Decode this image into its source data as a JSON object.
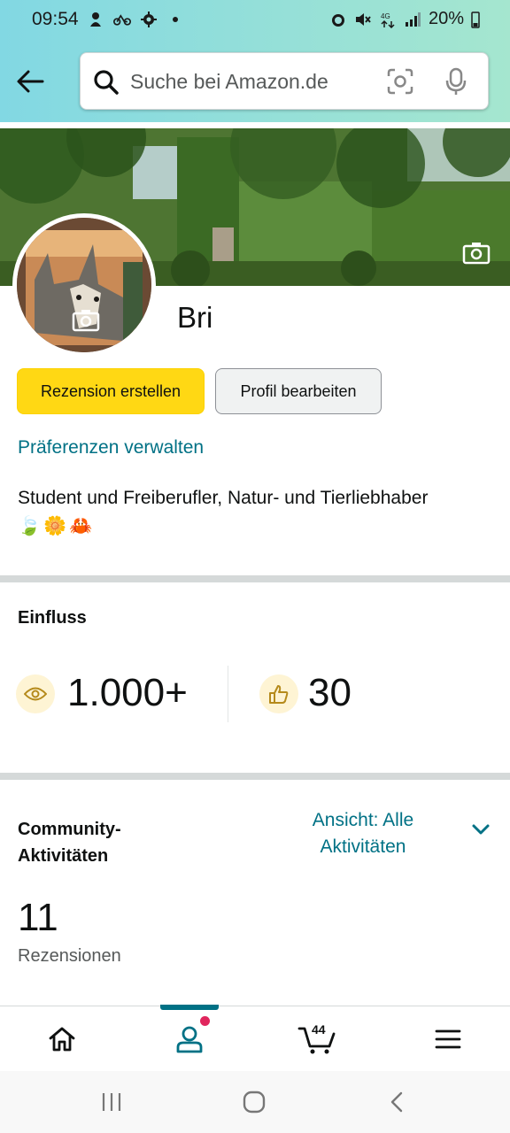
{
  "status_bar": {
    "time": "09:54",
    "battery": "20%",
    "network": "4G",
    "left_icons": [
      "notification-icon",
      "bike-icon",
      "settings-icon",
      "dot-icon"
    ],
    "right_icons": [
      "alarm-icon",
      "mute-icon",
      "data-icon",
      "signal-icon",
      "battery-icon"
    ]
  },
  "header": {
    "search_placeholder": "Suche bei Amazon.de"
  },
  "profile": {
    "name": "Bri",
    "create_review_label": "Rezension erstellen",
    "edit_profile_label": "Profil bearbeiten",
    "preferences_link": "Präferenzen verwalten",
    "bio": "Student und Freiberufler, Natur- und Tierliebhaber",
    "bio_emoji": [
      "🍃",
      "🌼",
      "🦀"
    ]
  },
  "influence": {
    "title": "Einfluss",
    "views": "1.000+",
    "helpful_votes": "30"
  },
  "community": {
    "title_line1": "Community-",
    "title_line2": "Aktivitäten",
    "view_line1": "Ansicht:  Alle",
    "view_line2": "Aktivitäten",
    "count": "11",
    "count_label": "Rezensionen"
  },
  "bottom_nav": {
    "cart_count": "44",
    "items": [
      "home",
      "profile",
      "cart",
      "menu"
    ],
    "active": "profile"
  },
  "colors": {
    "accent_teal": "#007185",
    "button_yellow": "#ffd814",
    "notification_dot": "#e0265d"
  }
}
